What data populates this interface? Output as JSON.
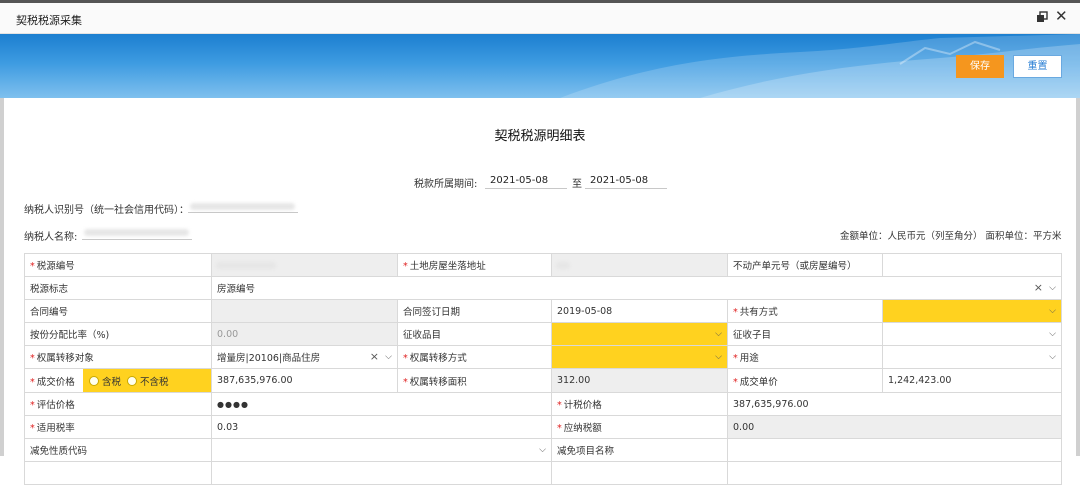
{
  "window": {
    "title": "契税税源采集",
    "restore_icon": "restore-icon",
    "close_icon": "close-icon"
  },
  "toolbar": {
    "save_label": "保存",
    "reset_label": "重置"
  },
  "form": {
    "title": "契税税源明细表",
    "period_label": "税款所属期间:",
    "period_start": "2021-05-08",
    "period_sep": "至",
    "period_end": "2021-05-08",
    "taxpayer_id_label": "纳税人识别号（统一社会信用代码）：",
    "taxpayer_name_label": "纳税人名称:",
    "unit_note": "金额单位：人民币元（列至角分）  面积单位：平方米"
  },
  "grid": {
    "tax_source_no": "税源编号",
    "land_address": "土地房屋坐落地址",
    "real_estate_unit_no": "不动产单元号（或房屋编号）",
    "tax_source_flag": "税源标志",
    "tax_source_flag_value": "房源编号",
    "contract_no": "合同编号",
    "contract_sign_date": "合同签订日期",
    "contract_sign_date_value": "2019-05-08",
    "co_ownership": "共有方式",
    "share_ratio": "按份分配比率（%)",
    "share_ratio_value": "0.00",
    "levy_item": "征收品目",
    "levy_subitem": "征收子目",
    "transfer_object": "权属转移对象",
    "transfer_object_value": "增量房|20106|商品住房",
    "transfer_method": "权属转移方式",
    "usage": "用途",
    "deal_price": "成交价格",
    "tax_incl": "含税",
    "tax_excl": "不含税",
    "deal_price_value": "387,635,976.00",
    "transfer_area": "权属转移面积",
    "transfer_area_value": "312.00",
    "unit_price": "成交单价",
    "unit_price_value": "1,242,423.00",
    "assessed_price": "评估价格",
    "assessed_price_value": "●●●●",
    "taxable_price": "计税价格",
    "taxable_price_value": "387,635,976.00",
    "tax_rate": "适用税率",
    "tax_rate_value": "0.03",
    "tax_payable": "应纳税额",
    "tax_payable_value": "0.00",
    "exemption_code": "减免性质代码",
    "exemption_item": "减免项目名称"
  },
  "colors": {
    "required": "#e02020",
    "highlight": "#ffd21f",
    "save": "#f5961e",
    "banner": "#2b8ad8"
  }
}
